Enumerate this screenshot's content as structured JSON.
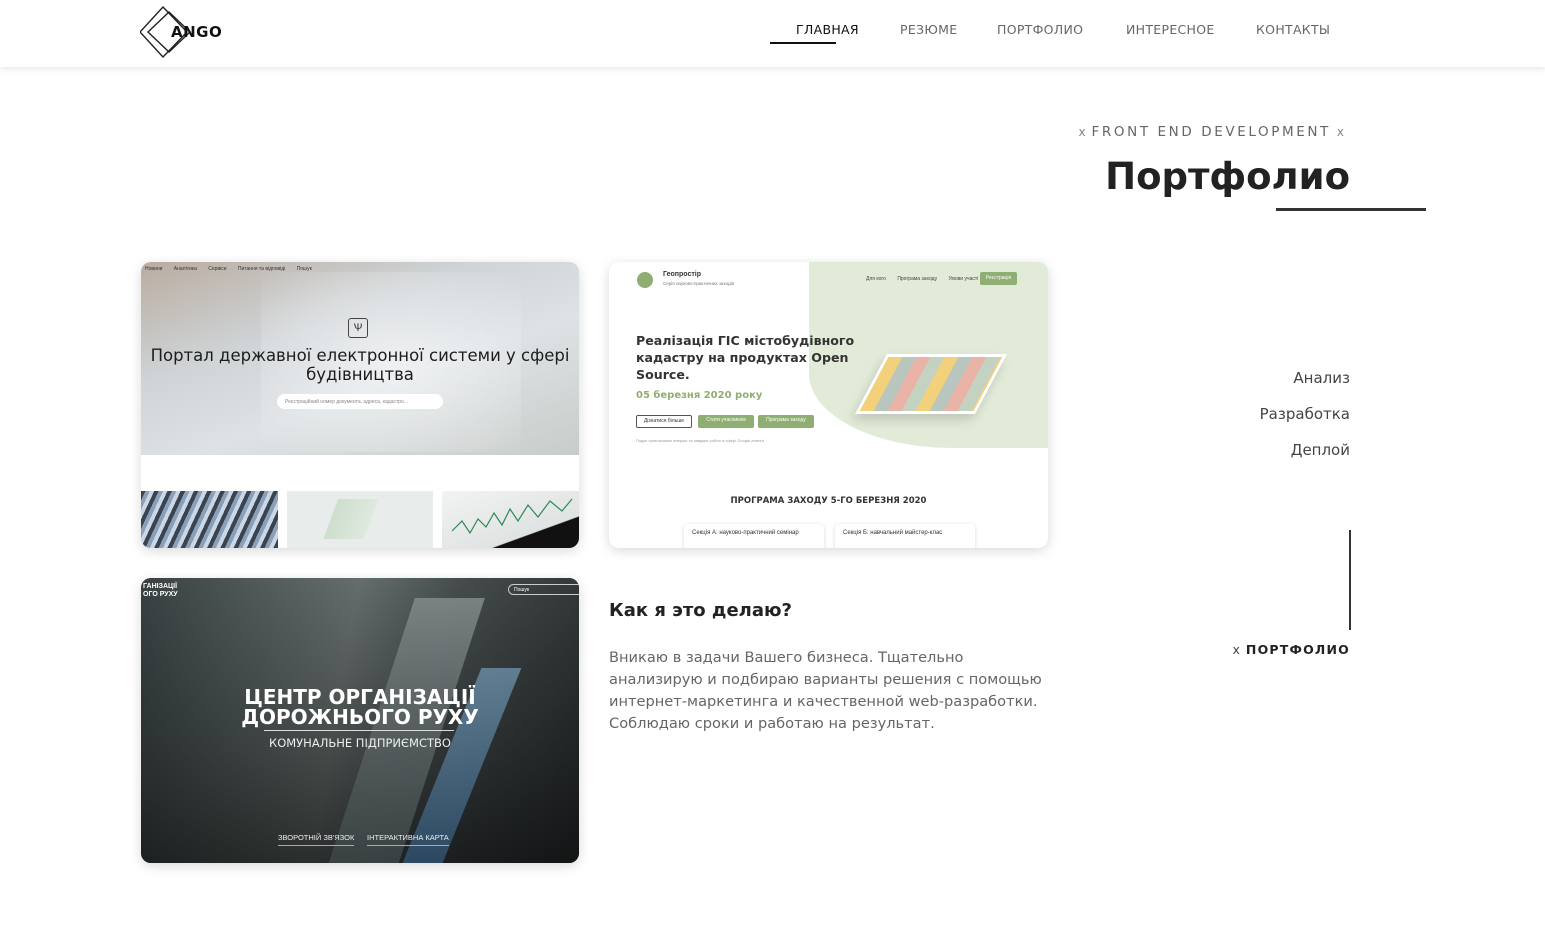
{
  "header": {
    "logo_text": "ANGO",
    "nav": [
      {
        "label": "ГЛАВНАЯ",
        "active": true
      },
      {
        "label": "РЕЗЮМЕ",
        "active": false
      },
      {
        "label": "ПОРТФОЛИО",
        "active": false
      },
      {
        "label": "ИНТЕРЕСНОЕ",
        "active": false
      },
      {
        "label": "КОНТАКТЫ",
        "active": false
      }
    ]
  },
  "hero": {
    "kicker_marker": "x",
    "kicker": "FRONT END DEVELOPMENT",
    "title": "Портфолио"
  },
  "portfolio": {
    "card1": {
      "nav": [
        "Новини",
        "Аналітика",
        "Сервіси",
        "Питання та відповіді",
        "Пошук"
      ],
      "emblem": "Ѱ",
      "title": "Портал державної електронної системи у сфері будівництва",
      "search_placeholder": "Реєстраційний номер документа, адреса, кадастро..."
    },
    "card2": {
      "brand": "Геопростір",
      "brand_sub": "Серія науково-практичних заходів",
      "menu": [
        "Для кого",
        "Програма заходу",
        "Умови участі"
      ],
      "register": "Реєстрація",
      "title": "Реалізація ГІС містобудівного кадастру на продуктах Open Source.",
      "date": "05 березня 2020 року",
      "buttons": [
        "Дізнатися більше",
        "Стати учасником",
        "Програма заходу"
      ],
      "note": "Подію організовано вперше та завдяки роботі в сфері Google-аналіті.",
      "program_title": "ПРОГРАМА ЗАХОДУ 5-ГО БЕРЕЗНЯ 2020",
      "section_a": "Секція А: науково-практичний семінар",
      "section_b": "Секція Б: навчальний майстер-клас"
    },
    "card3": {
      "corner": "ГАНІЗАЦІЇ\nОГО РУХУ",
      "search": "Пошук",
      "title_line1": "ЦЕНТР ОРГАНІЗАЦІЇ",
      "title_line2": "ДОРОЖНЬОГО РУХУ",
      "subtitle": "КОМУНАЛЬНЕ ПІДПРИЄМСТВО",
      "link1": "ЗВОРОТНІЙ ЗВ'ЯЗОК",
      "link2": "ІНТЕРАКТИВНА КАРТА"
    }
  },
  "how": {
    "title": "Как я это делаю?",
    "text": "Вникаю в задачи Вашего бизнеса. Тщательно анализирую и подбираю варианты решения с помощью интернет-маркетинга и качественной web-разработки. Соблюдаю сроки и работаю на результат."
  },
  "side": {
    "items": [
      "Анализ",
      "Разработка",
      "Деплой"
    ],
    "label_marker": "x",
    "label": "ПОРТФОЛИО"
  }
}
